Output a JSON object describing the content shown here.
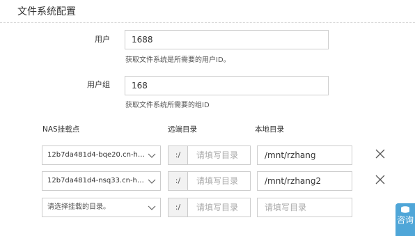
{
  "section": {
    "title": "文件系统配置"
  },
  "form": {
    "user": {
      "label": "用户",
      "value": "1688",
      "help": "获取文件系统是所需要的用户ID。"
    },
    "group": {
      "label": "用户组",
      "value": "168",
      "help": "获取文件系统所需要的组ID"
    }
  },
  "mounts": {
    "headers": {
      "nas": "NAS挂载点",
      "remote": "远端目录",
      "local": "本地目录"
    },
    "rows": [
      {
        "nas": "12b7da481d4-bqe20.cn-hon...",
        "remote_prefix": ":/",
        "remote_placeholder": "请填写目录",
        "local": "/mnt/rzhang"
      },
      {
        "nas": "12b7da481d4-nsq33.cn-hon...",
        "remote_prefix": ":/",
        "remote_placeholder": "请填写目录",
        "local": "/mnt/rzhang2"
      },
      {
        "nas_placeholder": "请选择挂载的目录。",
        "remote_prefix": ":/",
        "remote_placeholder": "请填写目录",
        "local_placeholder": "请填写目录"
      }
    ]
  },
  "consult": {
    "label": "咨询"
  },
  "icons": {
    "select": "chevron-down-icon",
    "delete": "close-icon",
    "consult": "consult-icon"
  },
  "colors": {
    "consult_tab": "#4fa6d8",
    "border": "#cccccc",
    "prefix_bg": "#f2f2f2"
  }
}
